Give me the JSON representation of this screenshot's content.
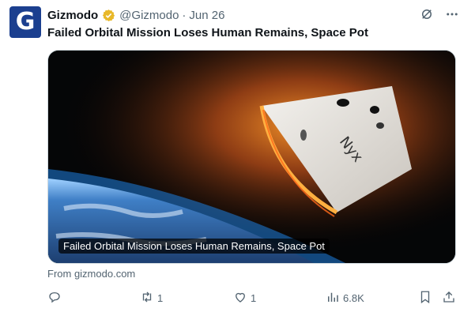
{
  "tweet": {
    "author_name": "Gizmodo",
    "handle": "@Gizmodo",
    "separator": "·",
    "date": "Jun 26",
    "avatar_letter": "G",
    "text": "Failed Orbital Mission Loses Human Remains, Space Pot"
  },
  "card": {
    "caption": "Failed Orbital Mission Loses Human Remains, Space Pot",
    "capsule_label": "Nyx",
    "source": "From gizmodo.com"
  },
  "actions": {
    "reply_count": "",
    "retweet_count": "1",
    "like_count": "1",
    "views_count": "6.8K"
  },
  "icons": [
    "verified-badge-icon",
    "grok-icon",
    "more-icon",
    "reply-icon",
    "retweet-icon",
    "like-icon",
    "views-icon",
    "bookmark-icon",
    "share-icon"
  ],
  "colors": {
    "verified": "#e8b829",
    "muted": "#536471",
    "avatar_bg": "#1b3f8f"
  }
}
